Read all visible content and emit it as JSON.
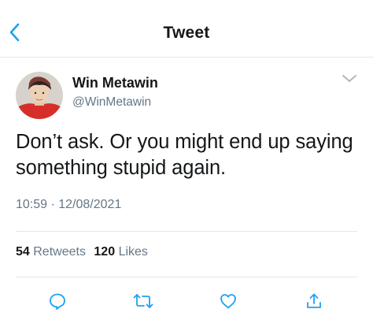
{
  "header": {
    "title": "Tweet",
    "back_icon": "chevron-left-icon"
  },
  "tweet": {
    "author": {
      "display_name": "Win Metawin",
      "handle": "@WinMetawin"
    },
    "text": "Don’t ask. Or you might end up saying something stupid again.",
    "timestamp": "10:59 · 12/08/2021",
    "stats": {
      "retweets_count": "54",
      "retweets_label": "Retweets",
      "likes_count": "120",
      "likes_label": "Likes"
    }
  },
  "actions": [
    {
      "icon": "reply-icon"
    },
    {
      "icon": "retweet-icon"
    },
    {
      "icon": "like-icon"
    },
    {
      "icon": "share-icon"
    }
  ],
  "colors": {
    "accent": "#1da1f2",
    "text_primary": "#14171a",
    "text_secondary": "#657786",
    "divider": "#e1e8ed"
  }
}
